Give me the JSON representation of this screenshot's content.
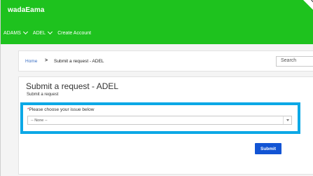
{
  "brand": "wadaEama",
  "nav": {
    "items": [
      {
        "label": "ADAMS"
      },
      {
        "label": "ADEL"
      },
      {
        "label": "Create Account"
      }
    ]
  },
  "breadcrumb": {
    "home": "Home",
    "separator": ">",
    "current": "Submit a request - ADEL"
  },
  "search": {
    "placeholder": "Search"
  },
  "form": {
    "title": "Submit a request - ADEL",
    "subtitle": "Submit a request",
    "issue_label": "Please choose your issue below",
    "required_marker": "*",
    "issue_value": "-- None --",
    "submit_label": "Submit"
  },
  "colors": {
    "header": "#1ec21e",
    "highlight": "#0ca8e6",
    "submit": "#1254d4"
  }
}
